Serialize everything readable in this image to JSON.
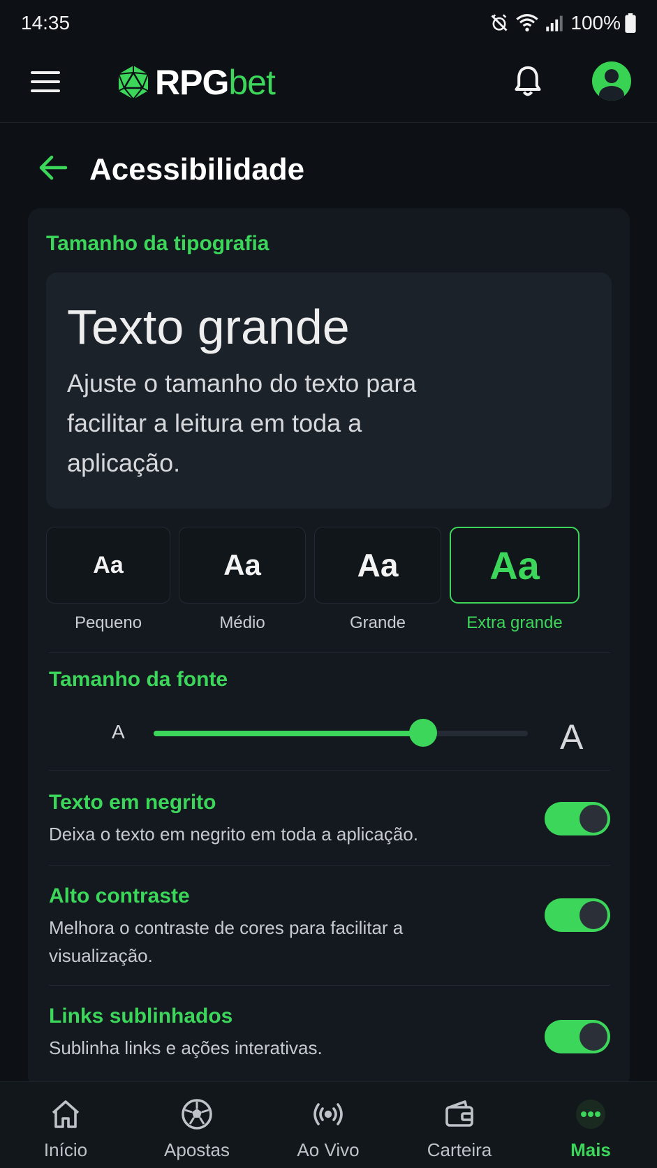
{
  "status_bar": {
    "time": "14:35",
    "battery": "100%"
  },
  "app_bar": {
    "logo_primary": "RPG",
    "logo_secondary": "bet"
  },
  "page": {
    "title": "Acessibilidade"
  },
  "typography": {
    "section_label": "Tamanho da tipografia",
    "preview_title": "Texto grande",
    "preview_body": "Ajuste o tamanho do texto para facilitar a leitura em toda a aplicação.",
    "options": [
      {
        "glyph": "Aa",
        "label": "Pequeno"
      },
      {
        "glyph": "Aa",
        "label": "Médio"
      },
      {
        "glyph": "Aa",
        "label": "Grande"
      },
      {
        "glyph": "Aa",
        "label": "Extra grande"
      }
    ],
    "selected": "Extra grande"
  },
  "font_size": {
    "label": "Tamanho da fonte",
    "min_glyph": "A",
    "max_glyph": "A",
    "value_fraction": 0.72
  },
  "settings": [
    {
      "title": "Texto em negrito",
      "description": "Deixa o texto em negrito em toda a aplicação.",
      "enabled": true
    },
    {
      "title": "Alto contraste",
      "description": "Melhora o contraste de cores para facilitar a visualização.",
      "enabled": true
    },
    {
      "title": "Links sublinhados",
      "description": "Sublinha links e ações interativas.",
      "enabled": true
    }
  ],
  "bottom_nav": [
    {
      "label": "Início",
      "icon": "home-icon"
    },
    {
      "label": "Apostas",
      "icon": "soccer-ball-icon"
    },
    {
      "label": "Ao Vivo",
      "icon": "live-broadcast-icon"
    },
    {
      "label": "Carteira",
      "icon": "wallet-icon"
    },
    {
      "label": "Mais",
      "icon": "more-dots-icon"
    }
  ],
  "active_nav": "Mais",
  "colors": {
    "accent": "#3bd65a",
    "background": "#0d1116",
    "card": "#14191f"
  }
}
